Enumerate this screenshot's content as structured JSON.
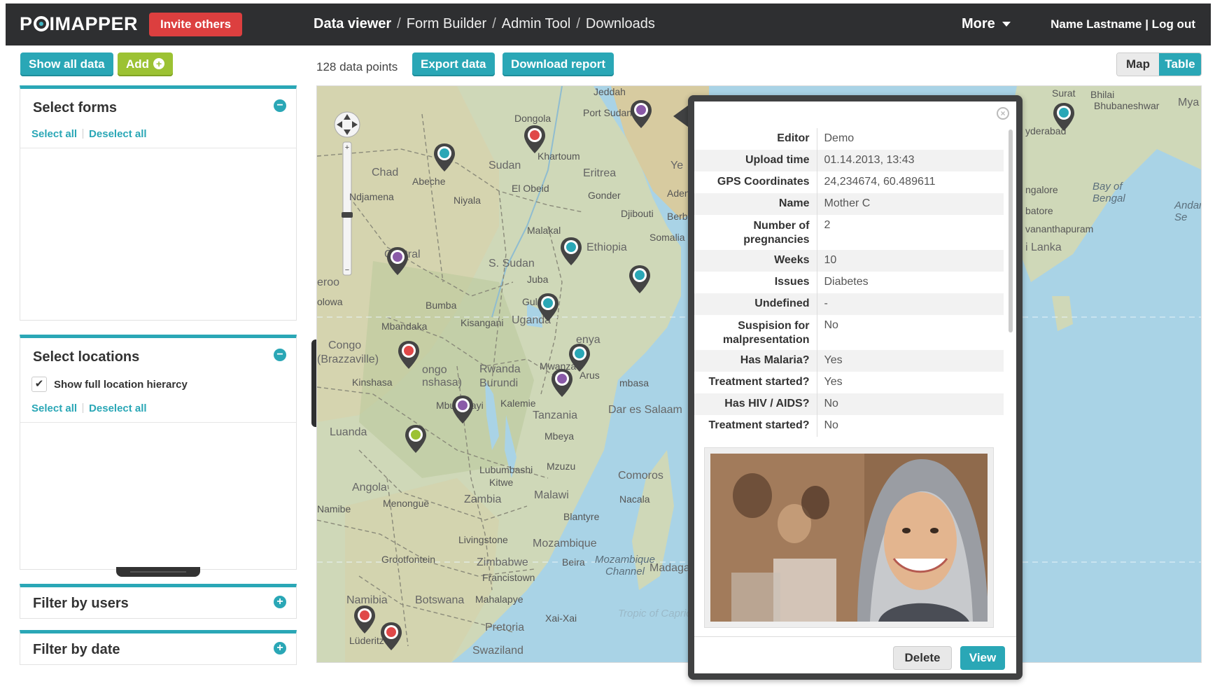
{
  "brand": {
    "logo_text_a": "P",
    "logo_text_b": "IMAPPER",
    "invite_label": "Invite others"
  },
  "nav": {
    "items": [
      "Data viewer",
      "Form Builder",
      "Admin Tool",
      "Downloads"
    ],
    "more_label": "More",
    "user_label": "Name Lastname | Log out"
  },
  "toolbar": {
    "show_all": "Show all data",
    "add": "Add",
    "count": "128 data points",
    "export": "Export data",
    "report": "Download report",
    "view_map": "Map",
    "view_table": "Table"
  },
  "forms_panel": {
    "title": "Select forms",
    "select_all": "Select all",
    "deselect_all": "Deselect all"
  },
  "locations_panel": {
    "title": "Select locations",
    "checkbox_label": "Show full location hierarcy",
    "checkbox_checked": true,
    "select_all": "Select all",
    "deselect_all": "Deselect all"
  },
  "users_panel": {
    "title": "Filter by users"
  },
  "date_panel": {
    "title": "Filter by date"
  },
  "map_labels": {
    "jeddah": "Jeddah",
    "port_sudan": "Port Sudan",
    "dongola": "Dongola",
    "khartoum": "Khartoum",
    "sudan": "Sudan",
    "chad": "Chad",
    "abeche": "Abeche",
    "ndjamena": "Ndjamena",
    "nyala": "Niyala",
    "el_obeid": "El Obeid",
    "eritrea": "Eritrea",
    "gonder": "Gonder",
    "aden": "Aden",
    "djibouti": "Djibouti",
    "berbera": "Berbera",
    "somalia": "Somalia",
    "malakal": "Malakal",
    "s_sudan": "S. Sudan",
    "ethiopia": "Ethiopia",
    "juba": "Juba",
    "central": "Central",
    "bumba": "Bumba",
    "gulu": "Gulu",
    "mbandaka": "Mbandaka",
    "kisangani": "Kisangani",
    "uganda": "Uganda",
    "kenya": "enya",
    "congo": "Congo",
    "brazzaville": "(Brazzaville)",
    "kinshasa": "Kinshasa",
    "rwanda": "Rwanda",
    "burundi": "Burundi",
    "mwanza": "Mwanza",
    "arusha": "Arus",
    "mombasa": "mbasa",
    "dar": "Dar es Salaam",
    "tanzania": "Tanzania",
    "kalemie": "Kalemie",
    "mbuji": "Mbuji-Mayi",
    "luanda": "Luanda",
    "mbeya": "Mbeya",
    "angola": "Angola",
    "lubumbashi": "Lubumbashi",
    "kitwe": "Kitwe",
    "mzuzu": "Mzuzu",
    "zambia": "Zambia",
    "malawi": "Malawi",
    "comoros": "Comoros",
    "nacala": "Nacala",
    "namibe": "Namibe",
    "menongue": "Menongue",
    "blantyre": "Blantyre",
    "livingstone": "Livingstone",
    "mozambique": "Mozambique",
    "grootfontein": "Grootfontein",
    "zimbabwe": "Zimbabwe",
    "beira": "Beira",
    "moz_channel": "Mozambique Channel",
    "madagascar": "Madagas",
    "francistown": "Francistown",
    "namibia": "Namibia",
    "botswana": "Botswana",
    "mahalapye": "Mahalapye",
    "tropic": "Tropic of Capric",
    "xai_xai": "Xai-Xai",
    "pretoria": "Pretoria",
    "luderitz": "Lüderitz",
    "swaziland": "Swaziland",
    "surat": "Surat",
    "bhilai": "Bhilai",
    "bhubaneshwar": "Bhubaneshwar",
    "mya": "Mya",
    "hyderabad": "yderabad",
    "bangalore": "ngalore",
    "bay_bengal": "Bay of Bengal",
    "coimbatore": "batore",
    "andaman": "Andar Se",
    "thiruvananthapuram": "vananthapuram",
    "sri_lanka": "i Lanka",
    "ye": "Ye",
    "eroo": "eroo",
    "olowa": "olowa",
    "kongo": "ongo",
    "nshasa": "nshasa)"
  },
  "popup": {
    "fields": [
      {
        "key": "Editor",
        "value": "Demo"
      },
      {
        "key": "Upload time",
        "value": "01.14.2013, 13:43"
      },
      {
        "key": "GPS Coordinates",
        "value": "24,234674, 60.489611"
      },
      {
        "key": "Name",
        "value": "Mother C"
      },
      {
        "key": "Number of pregnancies",
        "value": "2"
      },
      {
        "key": "Weeks",
        "value": "10"
      },
      {
        "key": "Issues",
        "value": "Diabetes"
      },
      {
        "key": "Undefined",
        "value": "-"
      },
      {
        "key": "Suspision for malpresentation",
        "value": "No"
      },
      {
        "key": "Has Malaria?",
        "value": "Yes"
      },
      {
        "key": "Treatment started?",
        "value": "Yes"
      },
      {
        "key": "Has HIV / AIDS?",
        "value": "No"
      },
      {
        "key": "Treatment started?",
        "value": "No"
      }
    ],
    "delete_label": "Delete",
    "view_label": "View"
  },
  "colors": {
    "accent": "#2aa7b6",
    "invite": "#dc3f3f",
    "add": "#9cc233",
    "topbar": "#2e2f31",
    "pin_teal": "#2aa7b6",
    "pin_red": "#e04848",
    "pin_purple": "#8a5aa8",
    "pin_green": "#9cc233"
  }
}
